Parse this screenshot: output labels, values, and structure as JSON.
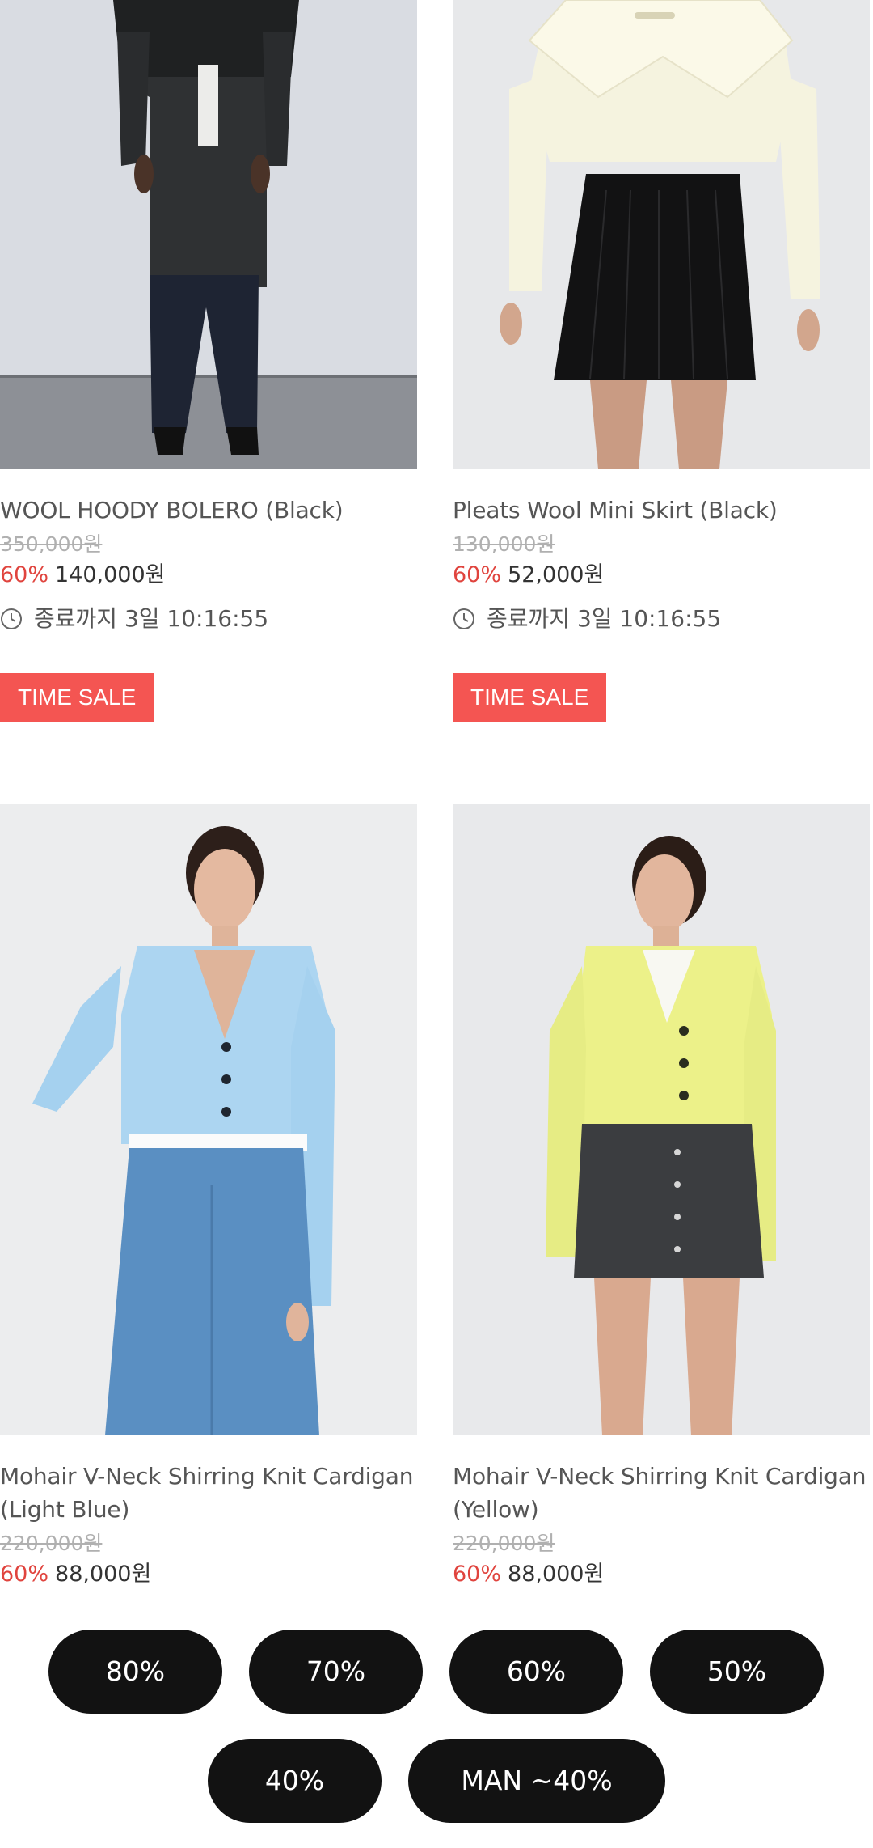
{
  "products": [
    {
      "name": "WOOL HOODY BOLERO (Black)",
      "original_price": "350,000원",
      "discount": "60%",
      "price": "140,000원",
      "countdown": "종료까지 3일 10:16:55",
      "badge": "TIME SALE"
    },
    {
      "name": "Pleats Wool Mini Skirt (Black)",
      "original_price": "130,000원",
      "discount": "60%",
      "price": "52,000원",
      "countdown": "종료까지 3일 10:16:55",
      "badge": "TIME SALE"
    },
    {
      "name": "Mohair V-Neck Shirring Knit Cardigan (Light Blue)",
      "original_price": "220,000원",
      "discount": "60%",
      "price": "88,000원"
    },
    {
      "name": "Mohair V-Neck Shirring Knit Cardigan (Yellow)",
      "original_price": "220,000원",
      "discount": "60%",
      "price": "88,000원"
    }
  ],
  "filters": [
    "80%",
    "70%",
    "60%",
    "50%",
    "40%",
    "MAN ~40%"
  ],
  "colors": {
    "discount": "#e0443e",
    "badge": "#f45552",
    "pill": "#121212"
  }
}
